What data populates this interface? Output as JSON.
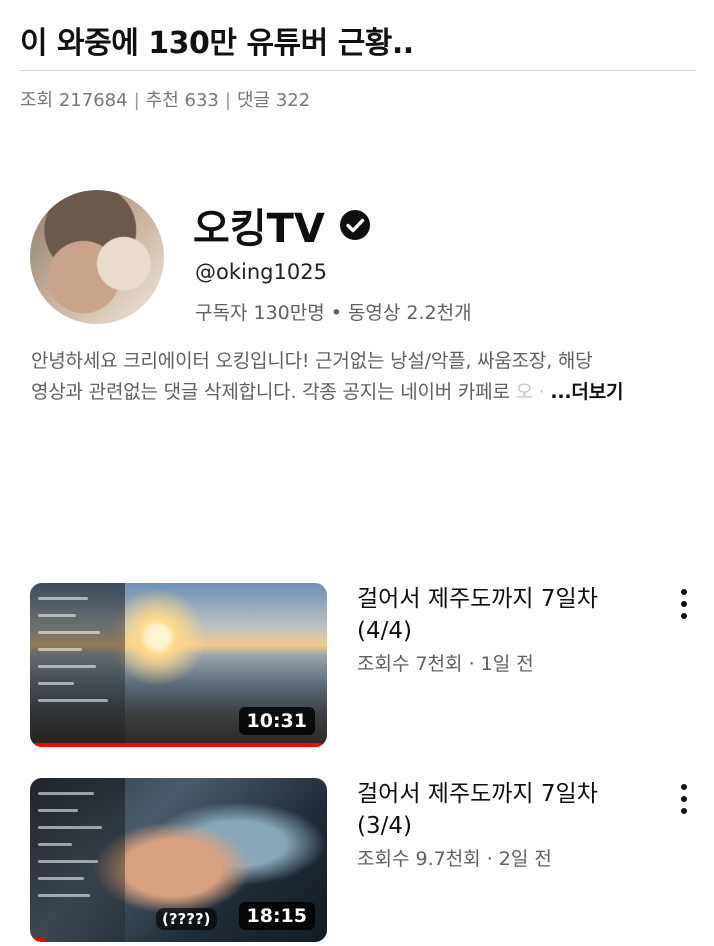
{
  "post": {
    "title": "이 와중에 130만 유튜버 근황..",
    "meta": {
      "views_label": "조회",
      "views": "217684",
      "recommend_label": "추천",
      "recommend": "633",
      "comments_label": "댓글",
      "comments": "322",
      "separator": "|"
    }
  },
  "channel": {
    "name": "오킹TV",
    "verified_icon": "verified-check-icon",
    "handle": "@oking1025",
    "subscribers": "구독자 130만명",
    "stats_separator": "•",
    "videos": "동영상 2.2천개",
    "description_line1": "안녕하세요 크리에이터 오킹입니다! 근거없는 낭설/악플, 싸움조장, 해당",
    "description_line2": "영상과 관련없는 댓글 삭제합니다. 각종 공지는 네이버 카페로 ",
    "description_fade": "오 ·",
    "more_label": "...더보기"
  },
  "videos": [
    {
      "title_line1": "걸어서 제주도까지 7일차",
      "title_line2": "(4/4)",
      "views": "조회수 7천회",
      "meta_separator": "·",
      "age": "1일 전",
      "duration": "10:31",
      "progress": 0.98
    },
    {
      "title_line1": "걸어서 제주도까지 7일차",
      "title_line2": "(3/4)",
      "views": "조회수 9.7천회",
      "meta_separator": "·",
      "age": "2일 전",
      "duration": "18:15",
      "caption": "(????)",
      "progress": 0.05
    }
  ],
  "colors": {
    "accent_progress": "#ff0000",
    "secondary_text": "#606060"
  }
}
